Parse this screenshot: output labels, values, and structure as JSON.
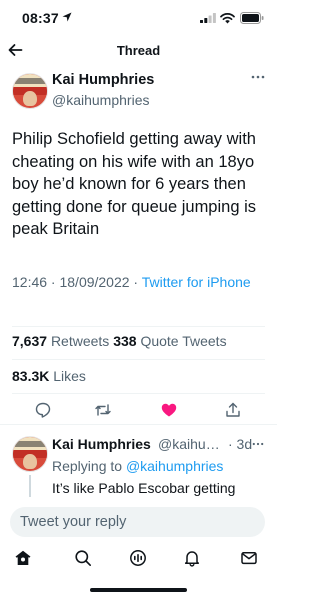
{
  "status_bar": {
    "time": "08:37"
  },
  "header": {
    "title": "Thread"
  },
  "tweet": {
    "author_name": "Kai Humphries",
    "author_handle": "@kaihumphries",
    "text": "Philip Schofield getting away with cheating on his wife with an 18yo boy he’d known for 6 years then getting done for queue jumping is peak Britain",
    "time": "12:46 · 18/09/2022 · ",
    "source": "Twitter for iPhone",
    "retweets_count": "7,637",
    "retweets_label": "Retweets",
    "quotes_count": "338",
    "quotes_label": "Quote Tweets",
    "likes_count": "83.3K",
    "likes_label": "Likes",
    "liked": true
  },
  "reply": {
    "author_name": "Kai Humphries",
    "author_handle": "@kaihumphries",
    "time": "· 3d",
    "replying_prefix": "Replying to ",
    "replying_handle": "@kaihumphries",
    "text": "It’s like Pablo Escobar getting"
  },
  "compose": {
    "placeholder": "Tweet your reply"
  },
  "icons": {
    "back": "arrow-left-icon",
    "more": "more-horizontal-icon",
    "reply": "comment-icon",
    "retweet": "retweet-icon",
    "like": "heart-icon",
    "share": "share-icon",
    "home": "home-icon",
    "search": "search-icon",
    "spaces": "spaces-icon",
    "notifications": "bell-icon",
    "messages": "mail-icon"
  },
  "colors": {
    "accent": "#1d9bf0",
    "like": "#f91880",
    "text_primary": "#0f1419",
    "text_secondary": "#536471"
  }
}
